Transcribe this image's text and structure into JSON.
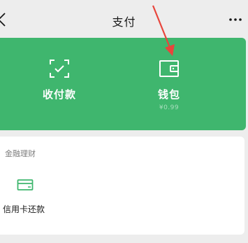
{
  "header": {
    "title": "支付",
    "back_icon": "chevron-left-icon",
    "more_icon": "ellipsis-icon"
  },
  "main_card": {
    "background": "#3fb66e",
    "entries": [
      {
        "label": "收付款",
        "icon": "scan-qr-icon"
      },
      {
        "label": "钱包",
        "icon": "wallet-icon",
        "balance": "¥0.99"
      }
    ]
  },
  "annotation": {
    "color": "#e8453c",
    "icon": "red-arrow"
  },
  "finance_section": {
    "title": "金融理财",
    "items": [
      {
        "label": "信用卡还款",
        "icon": "credit-card-icon",
        "color": "#3fb66e"
      }
    ]
  }
}
